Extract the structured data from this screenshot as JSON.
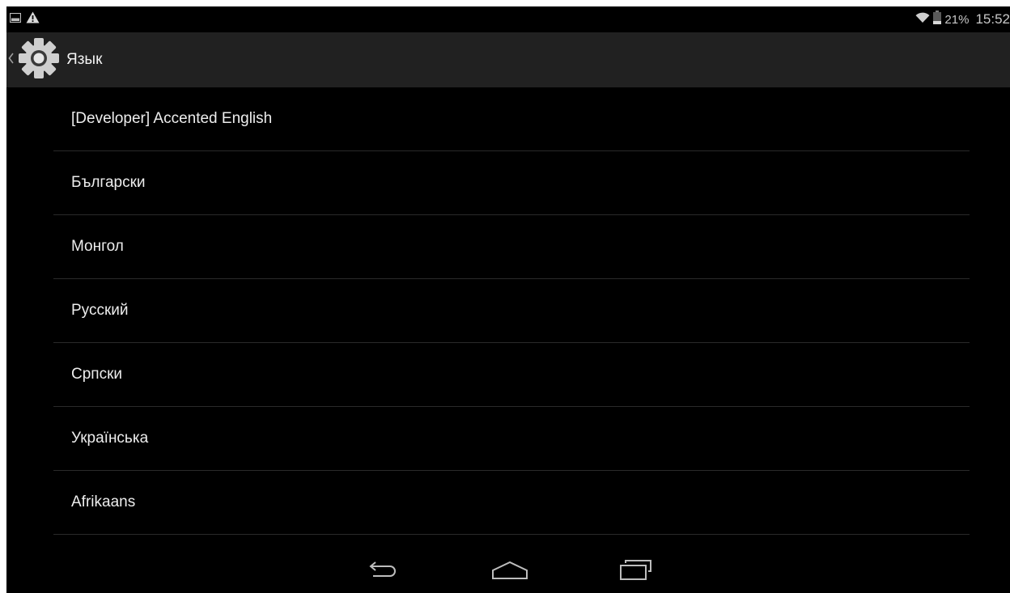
{
  "status_bar": {
    "battery_percent": "21%",
    "time": "15:52",
    "icons": [
      "gallery-notification-icon",
      "warning-icon",
      "wifi-icon",
      "battery-icon"
    ]
  },
  "action_bar": {
    "title": "Язык",
    "icons": [
      "back-caret-icon",
      "settings-gear-icon"
    ]
  },
  "languages": [
    "[Developer] Accented English",
    "Български",
    "Монгол",
    "Русский",
    "Српски",
    "Українська",
    "Afrikaans"
  ],
  "nav_bar": {
    "icons": [
      "back-icon",
      "home-icon",
      "recent-apps-icon"
    ]
  },
  "colors": {
    "background": "#000000",
    "action_bar": "#212121",
    "divider": "#2a2a2a",
    "text": "#ededed"
  }
}
